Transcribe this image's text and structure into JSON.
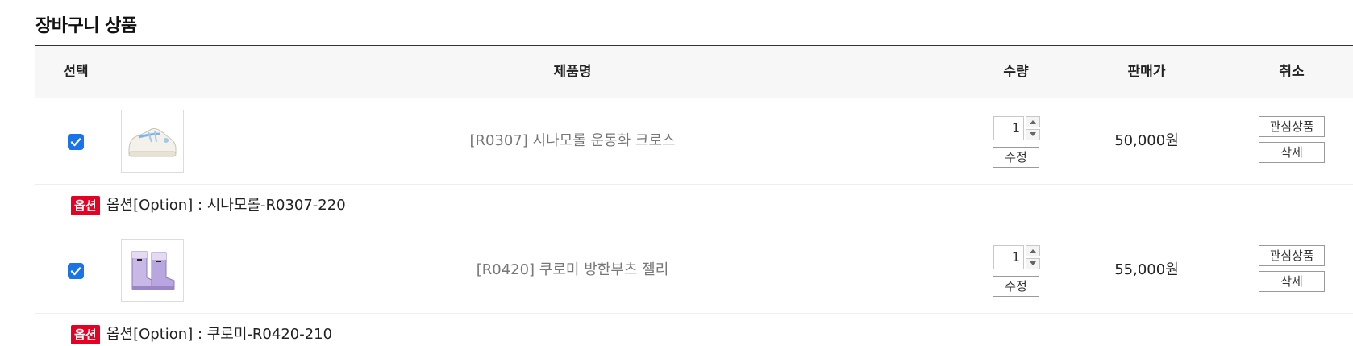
{
  "section_title": "장바구니 상품",
  "table_headers": {
    "select": "선택",
    "product_name": "제품명",
    "quantity": "수량",
    "price": "판매가",
    "cancel": "취소"
  },
  "items": [
    {
      "checked": true,
      "name": "[R0307] 시나모롤 운동화 크로스",
      "quantity": "1",
      "edit_label": "수정",
      "price": "50,000원",
      "wish_label": "관심상품",
      "delete_label": "삭제",
      "option_badge": "옵션",
      "option_text": "옵션[Option] : 시나모롤-R0307-220",
      "thumbnail_icon": "sneaker-icon"
    },
    {
      "checked": true,
      "name": "[R0420] 쿠로미 방한부츠 젤리",
      "quantity": "1",
      "edit_label": "수정",
      "price": "55,000원",
      "wish_label": "관심상품",
      "delete_label": "삭제",
      "option_badge": "옵션",
      "option_text": "옵션[Option] : 쿠로미-R0420-210",
      "thumbnail_icon": "boots-icon"
    }
  ],
  "colors": {
    "accent_blue": "#1a73e8",
    "option_badge_red": "#e60023",
    "header_bg": "#f7f7f7"
  }
}
